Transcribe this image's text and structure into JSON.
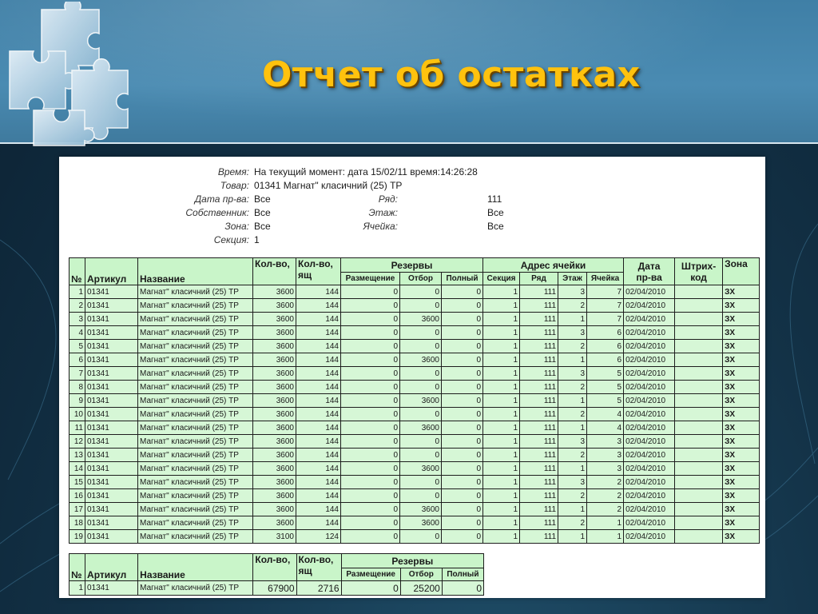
{
  "slide": {
    "title": "Отчет об остатках"
  },
  "filters": {
    "time_label": "Время:",
    "time_value": "На текущий момент: дата 15/02/11 время:14:26:28",
    "item_label": "Товар:",
    "item_value": "01341 Магнат\" класичний (25) ТР",
    "proddate_label": "Дата пр-ва:",
    "proddate_value": "Все",
    "owner_label": "Собственник:",
    "owner_value": "Все",
    "zone_label": "Зона:",
    "zone_value": "Все",
    "section_label": "Секция:",
    "section_value": "1",
    "row_label": "Ряд:",
    "row_value": "111",
    "floor_label": "Этаж:",
    "floor_value": "Все",
    "cell_label": "Ячейка:",
    "cell_value": "Все"
  },
  "main_table": {
    "headers": {
      "num": "№",
      "article": "Артикул",
      "name": "Название",
      "qty": "Кол-во,",
      "boxes_1": "Кол-во,",
      "boxes_2": "ящ",
      "reserves": "Резервы",
      "placement": "Размещение",
      "picking": "Отбор",
      "full": "Полный",
      "address": "Адрес ячейки",
      "section": "Секция",
      "row": "Ряд",
      "floor": "Этаж",
      "cell": "Ячейка",
      "date_1": "Дата",
      "date_2": "пр-ва",
      "barcode_1": "Штрих-",
      "barcode_2": "код",
      "zone": "Зона"
    },
    "rows": [
      {
        "n": "1",
        "article": "01341",
        "name": "Магнат\" класичний (25) ТР",
        "qty": "3600",
        "boxes": "144",
        "placement": "0",
        "picking": "0",
        "full": "0",
        "section": "1",
        "row": "111",
        "floor": "3",
        "cell": "7",
        "date": "02/04/2010",
        "barcode": "",
        "zone": "ЗХ"
      },
      {
        "n": "2",
        "article": "01341",
        "name": "Магнат\" класичний (25) ТР",
        "qty": "3600",
        "boxes": "144",
        "placement": "0",
        "picking": "0",
        "full": "0",
        "section": "1",
        "row": "111",
        "floor": "2",
        "cell": "7",
        "date": "02/04/2010",
        "barcode": "",
        "zone": "ЗХ"
      },
      {
        "n": "3",
        "article": "01341",
        "name": "Магнат\" класичний (25) ТР",
        "qty": "3600",
        "boxes": "144",
        "placement": "0",
        "picking": "3600",
        "full": "0",
        "section": "1",
        "row": "111",
        "floor": "1",
        "cell": "7",
        "date": "02/04/2010",
        "barcode": "",
        "zone": "ЗХ"
      },
      {
        "n": "4",
        "article": "01341",
        "name": "Магнат\" класичний (25) ТР",
        "qty": "3600",
        "boxes": "144",
        "placement": "0",
        "picking": "0",
        "full": "0",
        "section": "1",
        "row": "111",
        "floor": "3",
        "cell": "6",
        "date": "02/04/2010",
        "barcode": "",
        "zone": "ЗХ"
      },
      {
        "n": "5",
        "article": "01341",
        "name": "Магнат\" класичний (25) ТР",
        "qty": "3600",
        "boxes": "144",
        "placement": "0",
        "picking": "0",
        "full": "0",
        "section": "1",
        "row": "111",
        "floor": "2",
        "cell": "6",
        "date": "02/04/2010",
        "barcode": "",
        "zone": "ЗХ"
      },
      {
        "n": "6",
        "article": "01341",
        "name": "Магнат\" класичний (25) ТР",
        "qty": "3600",
        "boxes": "144",
        "placement": "0",
        "picking": "3600",
        "full": "0",
        "section": "1",
        "row": "111",
        "floor": "1",
        "cell": "6",
        "date": "02/04/2010",
        "barcode": "",
        "zone": "ЗХ"
      },
      {
        "n": "7",
        "article": "01341",
        "name": "Магнат\" класичний (25) ТР",
        "qty": "3600",
        "boxes": "144",
        "placement": "0",
        "picking": "0",
        "full": "0",
        "section": "1",
        "row": "111",
        "floor": "3",
        "cell": "5",
        "date": "02/04/2010",
        "barcode": "",
        "zone": "ЗХ"
      },
      {
        "n": "8",
        "article": "01341",
        "name": "Магнат\" класичний (25) ТР",
        "qty": "3600",
        "boxes": "144",
        "placement": "0",
        "picking": "0",
        "full": "0",
        "section": "1",
        "row": "111",
        "floor": "2",
        "cell": "5",
        "date": "02/04/2010",
        "barcode": "",
        "zone": "ЗХ"
      },
      {
        "n": "9",
        "article": "01341",
        "name": "Магнат\" класичний (25) ТР",
        "qty": "3600",
        "boxes": "144",
        "placement": "0",
        "picking": "3600",
        "full": "0",
        "section": "1",
        "row": "111",
        "floor": "1",
        "cell": "5",
        "date": "02/04/2010",
        "barcode": "",
        "zone": "ЗХ"
      },
      {
        "n": "10",
        "article": "01341",
        "name": "Магнат\" класичний (25) ТР",
        "qty": "3600",
        "boxes": "144",
        "placement": "0",
        "picking": "0",
        "full": "0",
        "section": "1",
        "row": "111",
        "floor": "2",
        "cell": "4",
        "date": "02/04/2010",
        "barcode": "",
        "zone": "ЗХ"
      },
      {
        "n": "11",
        "article": "01341",
        "name": "Магнат\" класичний (25) ТР",
        "qty": "3600",
        "boxes": "144",
        "placement": "0",
        "picking": "3600",
        "full": "0",
        "section": "1",
        "row": "111",
        "floor": "1",
        "cell": "4",
        "date": "02/04/2010",
        "barcode": "",
        "zone": "ЗХ"
      },
      {
        "n": "12",
        "article": "01341",
        "name": "Магнат\" класичний (25) ТР",
        "qty": "3600",
        "boxes": "144",
        "placement": "0",
        "picking": "0",
        "full": "0",
        "section": "1",
        "row": "111",
        "floor": "3",
        "cell": "3",
        "date": "02/04/2010",
        "barcode": "",
        "zone": "ЗХ"
      },
      {
        "n": "13",
        "article": "01341",
        "name": "Магнат\" класичний (25) ТР",
        "qty": "3600",
        "boxes": "144",
        "placement": "0",
        "picking": "0",
        "full": "0",
        "section": "1",
        "row": "111",
        "floor": "2",
        "cell": "3",
        "date": "02/04/2010",
        "barcode": "",
        "zone": "ЗХ"
      },
      {
        "n": "14",
        "article": "01341",
        "name": "Магнат\" класичний (25) ТР",
        "qty": "3600",
        "boxes": "144",
        "placement": "0",
        "picking": "3600",
        "full": "0",
        "section": "1",
        "row": "111",
        "floor": "1",
        "cell": "3",
        "date": "02/04/2010",
        "barcode": "",
        "zone": "ЗХ"
      },
      {
        "n": "15",
        "article": "01341",
        "name": "Магнат\" класичний (25) ТР",
        "qty": "3600",
        "boxes": "144",
        "placement": "0",
        "picking": "0",
        "full": "0",
        "section": "1",
        "row": "111",
        "floor": "3",
        "cell": "2",
        "date": "02/04/2010",
        "barcode": "",
        "zone": "ЗХ"
      },
      {
        "n": "16",
        "article": "01341",
        "name": "Магнат\" класичний (25) ТР",
        "qty": "3600",
        "boxes": "144",
        "placement": "0",
        "picking": "0",
        "full": "0",
        "section": "1",
        "row": "111",
        "floor": "2",
        "cell": "2",
        "date": "02/04/2010",
        "barcode": "",
        "zone": "ЗХ"
      },
      {
        "n": "17",
        "article": "01341",
        "name": "Магнат\" класичний (25) ТР",
        "qty": "3600",
        "boxes": "144",
        "placement": "0",
        "picking": "3600",
        "full": "0",
        "section": "1",
        "row": "111",
        "floor": "1",
        "cell": "2",
        "date": "02/04/2010",
        "barcode": "",
        "zone": "ЗХ"
      },
      {
        "n": "18",
        "article": "01341",
        "name": "Магнат\" класичний (25) ТР",
        "qty": "3600",
        "boxes": "144",
        "placement": "0",
        "picking": "3600",
        "full": "0",
        "section": "1",
        "row": "111",
        "floor": "2",
        "cell": "1",
        "date": "02/04/2010",
        "barcode": "",
        "zone": "ЗХ"
      },
      {
        "n": "19",
        "article": "01341",
        "name": "Магнат\" класичний (25) ТР",
        "qty": "3100",
        "boxes": "124",
        "placement": "0",
        "picking": "0",
        "full": "0",
        "section": "1",
        "row": "111",
        "floor": "1",
        "cell": "1",
        "date": "02/04/2010",
        "barcode": "",
        "zone": "ЗХ"
      }
    ]
  },
  "totals_table": {
    "headers": {
      "num": "№",
      "article": "Артикул",
      "name": "Название",
      "qty": "Кол-во,",
      "boxes_1": "Кол-во,",
      "boxes_2": "ящ",
      "reserves": "Резервы",
      "placement": "Размещение",
      "picking": "Отбор",
      "full": "Полный"
    },
    "row": {
      "n": "1",
      "article": "01341",
      "name": "Магнат\" класичний (25) ТР",
      "qty": "67900",
      "boxes": "2716",
      "placement": "0",
      "picking": "25200",
      "full": "0"
    }
  },
  "colors": {
    "title": "#ffc20e",
    "header_band": "#4a8bb2",
    "table_header": "#c9f5c9",
    "table_cell": "#d6f7d6",
    "background": "#133247"
  },
  "icons": {
    "logo": "puzzle-pieces-icon"
  }
}
